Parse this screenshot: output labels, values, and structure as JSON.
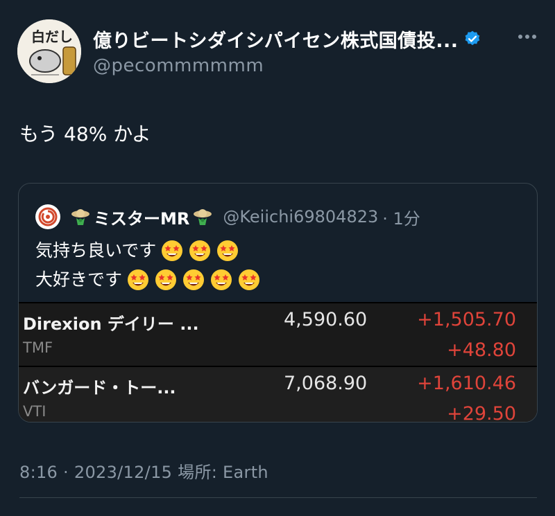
{
  "author": {
    "display_name": "億りビートシダイシパイセン株式国債投...",
    "handle": "@pecommmmmm",
    "avatar_icon": "user-avatar-icon",
    "verified_icon": "verified-badge-icon",
    "verified_color": "#1d9bf0"
  },
  "tweet": {
    "text": "もう 48% かよ"
  },
  "quoted": {
    "name": "ミスターMR",
    "handle": "@Keiichi69804823",
    "time": "· 1分",
    "lines": [
      "気持ち良いです",
      "大好きです"
    ],
    "line_emoji_counts": [
      3,
      5
    ],
    "emoji_icon": "star-struck-emoji-icon",
    "holdings": [
      {
        "name": "Direxion デイリー ...",
        "ticker": "TMF",
        "value": "4,590.60",
        "gain": "+1,505.70",
        "gain_pct": "+48.80"
      },
      {
        "name": "バンガード・トー...",
        "ticker": "VTI",
        "value": "7,068.90",
        "gain": "+1,610.46",
        "gain_pct": "+29.50"
      }
    ]
  },
  "meta": {
    "timestamp": "8:16 · 2023/12/15 場所: Earth"
  },
  "colors": {
    "background": "#15202b",
    "muted": "#8b98a5",
    "gain_red": "#e0443a"
  }
}
